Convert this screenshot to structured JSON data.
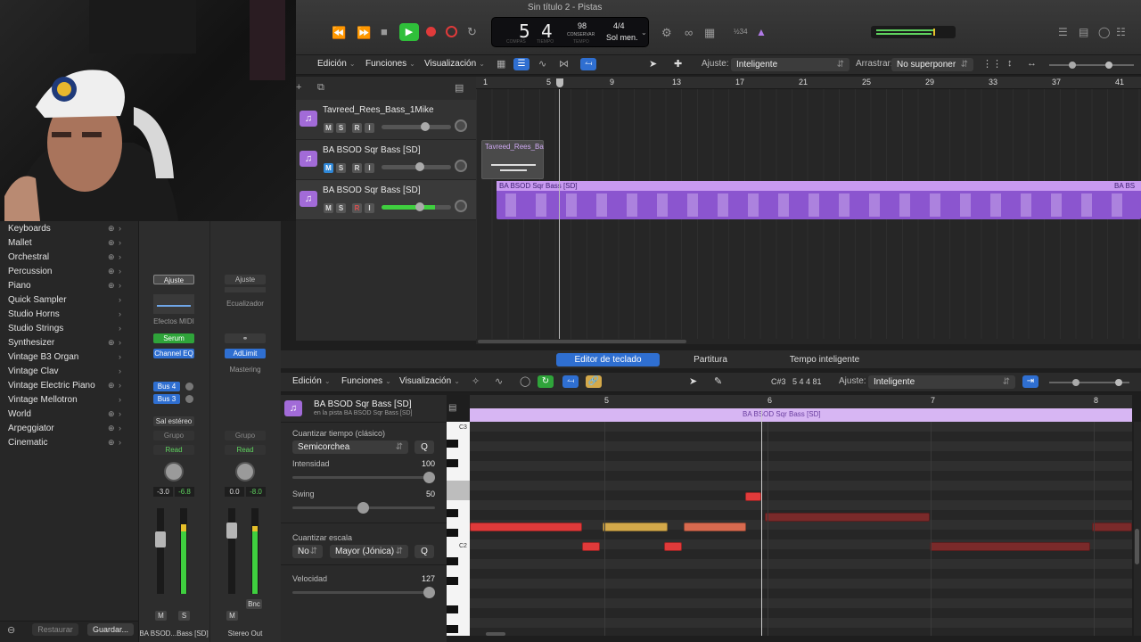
{
  "window": {
    "title": "Sin título 2 - Pistas"
  },
  "lcd": {
    "bar": "5",
    "beat": "4",
    "bar_caption": "COMPÁS",
    "beat_caption": "TIEMPO",
    "tempo": "98",
    "tempo_mode": "CONSERVAR",
    "tempo_caption": "TEMPO",
    "signature": "4/4",
    "key": "Sol men."
  },
  "control_bar": {
    "cpu_label": "½34"
  },
  "tracks_toolbar": {
    "menus": [
      "Edición",
      "Funciones",
      "Visualización"
    ],
    "snap_label": "Ajuste:",
    "snap_value": "Inteligente",
    "drag_label": "Arrastrar:",
    "drag_value": "No superponer"
  },
  "ruler": {
    "marks": [
      "1",
      "5",
      "9",
      "13",
      "17",
      "21",
      "25",
      "29",
      "33",
      "37",
      "41"
    ]
  },
  "tracks": [
    {
      "name": "Tavreed_Rees_Bass_1Mike",
      "buttons": [
        "M",
        "S",
        "R",
        "I"
      ]
    },
    {
      "name": "BA BSOD Sqr Bass [SD]",
      "buttons": [
        "M",
        "S",
        "R",
        "I"
      ]
    },
    {
      "name": "BA BSOD Sqr Bass [SD]",
      "buttons": [
        "M",
        "S",
        "R",
        "I"
      ]
    }
  ],
  "regions": {
    "audio_region": "Tavreed_Rees_Ba",
    "midi_region": "BA BSOD Sqr Bass [SD]",
    "midi_region_end": "BA BS"
  },
  "library": {
    "items": [
      {
        "label": "Keyboards",
        "plus": true
      },
      {
        "label": "Mallet",
        "plus": true
      },
      {
        "label": "Orchestral",
        "plus": true
      },
      {
        "label": "Percussion",
        "plus": true
      },
      {
        "label": "Piano",
        "plus": true
      },
      {
        "label": "Quick Sampler",
        "plus": false
      },
      {
        "label": "Studio Horns",
        "plus": false
      },
      {
        "label": "Studio Strings",
        "plus": false
      },
      {
        "label": "Synthesizer",
        "plus": true
      },
      {
        "label": "Vintage B3 Organ",
        "plus": false
      },
      {
        "label": "Vintage Clav",
        "plus": false
      },
      {
        "label": "Vintage Electric Piano",
        "plus": true
      },
      {
        "label": "Vintage Mellotron",
        "plus": false
      },
      {
        "label": "World",
        "plus": true
      },
      {
        "label": "Arpeggiator",
        "plus": true
      },
      {
        "label": "Cinematic",
        "plus": true
      }
    ],
    "restore": "Restaurar",
    "save": "Guardar..."
  },
  "mixer": {
    "strip1": {
      "setting": "Ajuste",
      "midi_fx": "Efectos MIDI",
      "instrument": "Serum",
      "eq": "Channel EQ",
      "sends": [
        "Bus 4",
        "Bus 3"
      ],
      "output": "Sal estéreo",
      "group": "Grupo",
      "automation": "Read",
      "volume": "-3.0",
      "peak": "-6.8",
      "buttons": [
        "M",
        "S"
      ],
      "name": "BA BSOD...Bass [SD]"
    },
    "strip2": {
      "setting": "Ajuste",
      "eq_label": "Ecualizador",
      "limiter": "AdLimit",
      "mastering": "Mastering",
      "group": "Grupo",
      "automation": "Read",
      "volume": "0.0",
      "peak": "-8.0",
      "buttons": [
        "M"
      ],
      "bounce": "Bnc",
      "name": "Stereo Out"
    }
  },
  "editor": {
    "tabs": [
      "Editor de teclado",
      "Partitura",
      "Tempo inteligente"
    ],
    "menus": [
      "Edición",
      "Funciones",
      "Visualización"
    ],
    "position": "C#3   5 4 4 81",
    "snap_label": "Ajuste:",
    "snap_value": "Inteligente",
    "region_name": "BA BSOD Sqr Bass [SD]",
    "region_sub": "en la pista BA BSOD Sqr Bass [SD]",
    "ruler_marks": [
      "5",
      "6",
      "7",
      "8"
    ],
    "region_bar_label": "BA BSOD Sqr Bass [SD]",
    "octave_labels": [
      "C3",
      "C2"
    ]
  },
  "inspector": {
    "quantize_label": "Cuantizar tiempo (clásico)",
    "quantize_value": "Semicorchea",
    "q_button": "Q",
    "strength_label": "Intensidad",
    "strength_value": "100",
    "swing_label": "Swing",
    "swing_value": "50",
    "scale_label": "Cuantizar escala",
    "scale_no": "No",
    "scale_value": "Mayor (Jónica)",
    "velocity_label": "Velocidad",
    "velocity_value": "127"
  },
  "colors": {
    "accent_blue": "#2f6fd1",
    "track_purple": "#a26bd8",
    "region_purple": "#c89af0",
    "note_red": "#e03a3a",
    "note_gold": "#d4a94a",
    "note_salmon": "#d86a4f",
    "play_green": "#2fbf3a"
  }
}
